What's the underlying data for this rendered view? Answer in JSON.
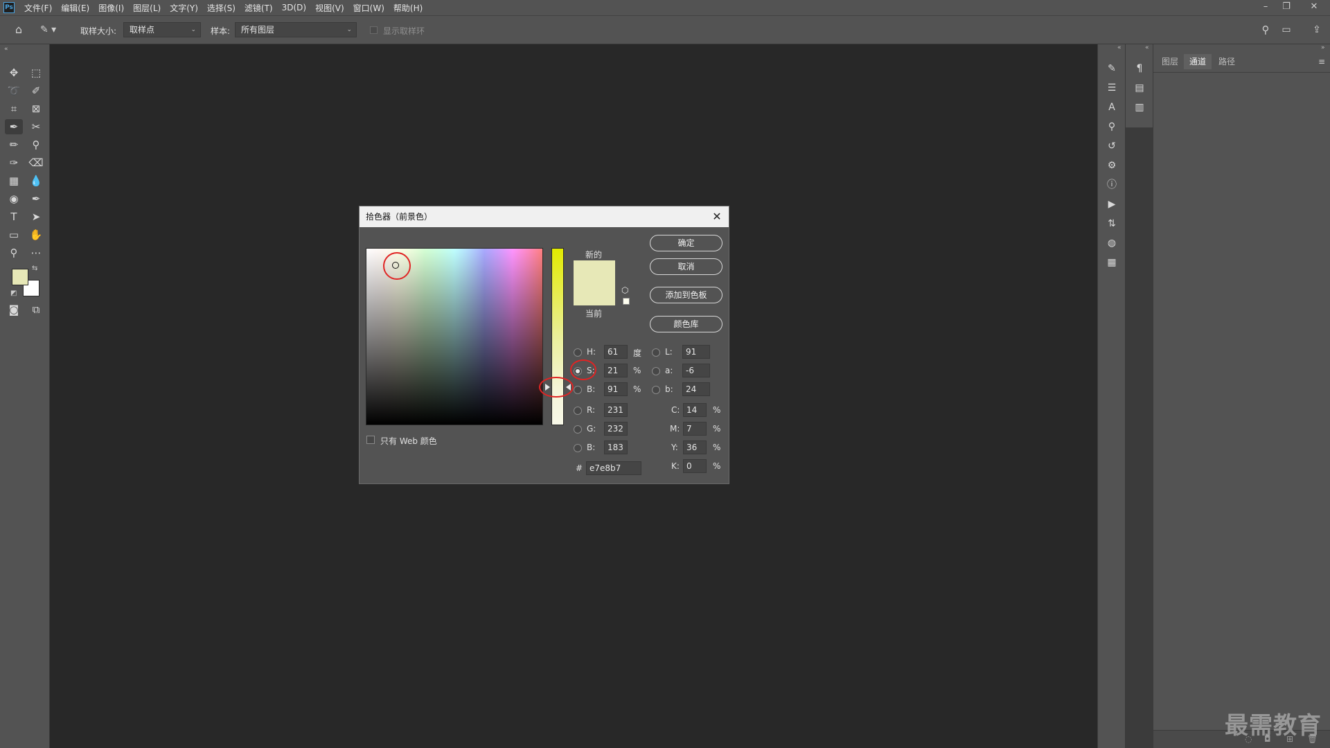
{
  "menubar": {
    "logo": "Ps",
    "items": [
      "文件(F)",
      "编辑(E)",
      "图像(I)",
      "图层(L)",
      "文字(Y)",
      "选择(S)",
      "滤镜(T)",
      "3D(D)",
      "视图(V)",
      "窗口(W)",
      "帮助(H)"
    ]
  },
  "options": {
    "sample_size_label": "取样大小:",
    "sample_size_value": "取样点",
    "sample_label": "样本:",
    "sample_value": "所有图层",
    "show_ring_label": "显示取样环"
  },
  "toolbar": {
    "foreground_color": "#e7e8b7",
    "background_color": "#ffffff"
  },
  "panel": {
    "tabs": [
      "图层",
      "通道",
      "路径"
    ],
    "active_tab": "通道"
  },
  "dialog": {
    "title": "拾色器（前景色）",
    "buttons": {
      "ok": "确定",
      "cancel": "取消",
      "add_to_swatches": "添加到色板",
      "color_libraries": "颜色库"
    },
    "new_label": "新的",
    "current_label": "当前",
    "new_color": "#e7e8b7",
    "current_color": "#e7e8b7",
    "web_only_label": "只有 Web 颜色",
    "selected_mode": "S",
    "hsb": [
      {
        "label": "H:",
        "value": "61",
        "unit": "度"
      },
      {
        "label": "S:",
        "value": "21",
        "unit": "%"
      },
      {
        "label": "B:",
        "value": "91",
        "unit": "%"
      }
    ],
    "lab": [
      {
        "label": "L:",
        "value": "91"
      },
      {
        "label": "a:",
        "value": "-6"
      },
      {
        "label": "b:",
        "value": "24"
      }
    ],
    "rgb": [
      {
        "label": "R:",
        "value": "231"
      },
      {
        "label": "G:",
        "value": "232"
      },
      {
        "label": "B:",
        "value": "183"
      }
    ],
    "cmyk": [
      {
        "label": "C:",
        "value": "14",
        "unit": "%"
      },
      {
        "label": "M:",
        "value": "7",
        "unit": "%"
      },
      {
        "label": "Y:",
        "value": "36",
        "unit": "%"
      },
      {
        "label": "K:",
        "value": "0",
        "unit": "%"
      }
    ],
    "hex_label": "#",
    "hex_value": "e7e8b7"
  },
  "watermark": "最需教育"
}
